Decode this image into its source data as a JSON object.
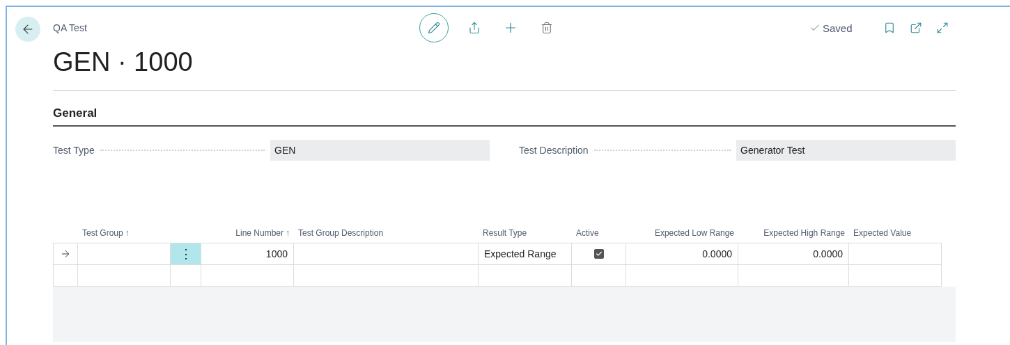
{
  "header": {
    "breadcrumb": "QA Test",
    "title": "GEN · 1000",
    "status": "Saved"
  },
  "section": {
    "title": "General",
    "fields": [
      {
        "label": "Test Type",
        "value": "GEN"
      },
      {
        "label": "Test Description",
        "value": "Generator Test"
      }
    ]
  },
  "table": {
    "columns": [
      {
        "label": "Test Group",
        "sort_mark": "↑",
        "kind": "text"
      },
      {
        "kind": "menu"
      },
      {
        "label": "Line Number",
        "sort_mark": "↑",
        "kind": "number"
      },
      {
        "label": "Test Group Description",
        "kind": "text"
      },
      {
        "label": "Result Type",
        "kind": "text"
      },
      {
        "label": "Active",
        "kind": "check"
      },
      {
        "label": "Expected Low Range",
        "kind": "number"
      },
      {
        "label": "Expected High Range",
        "kind": "number"
      },
      {
        "label": "Expected Value",
        "kind": "text"
      }
    ],
    "rows": [
      {
        "current": true,
        "cells": [
          {},
          {
            "menu": "⋮"
          },
          {
            "text": "1000"
          },
          {},
          {
            "text": "Expected Range"
          },
          {
            "checked": true
          },
          {
            "text": "0.0000"
          },
          {
            "text": "0.0000"
          },
          {}
        ]
      },
      {
        "current": false
      }
    ]
  }
}
